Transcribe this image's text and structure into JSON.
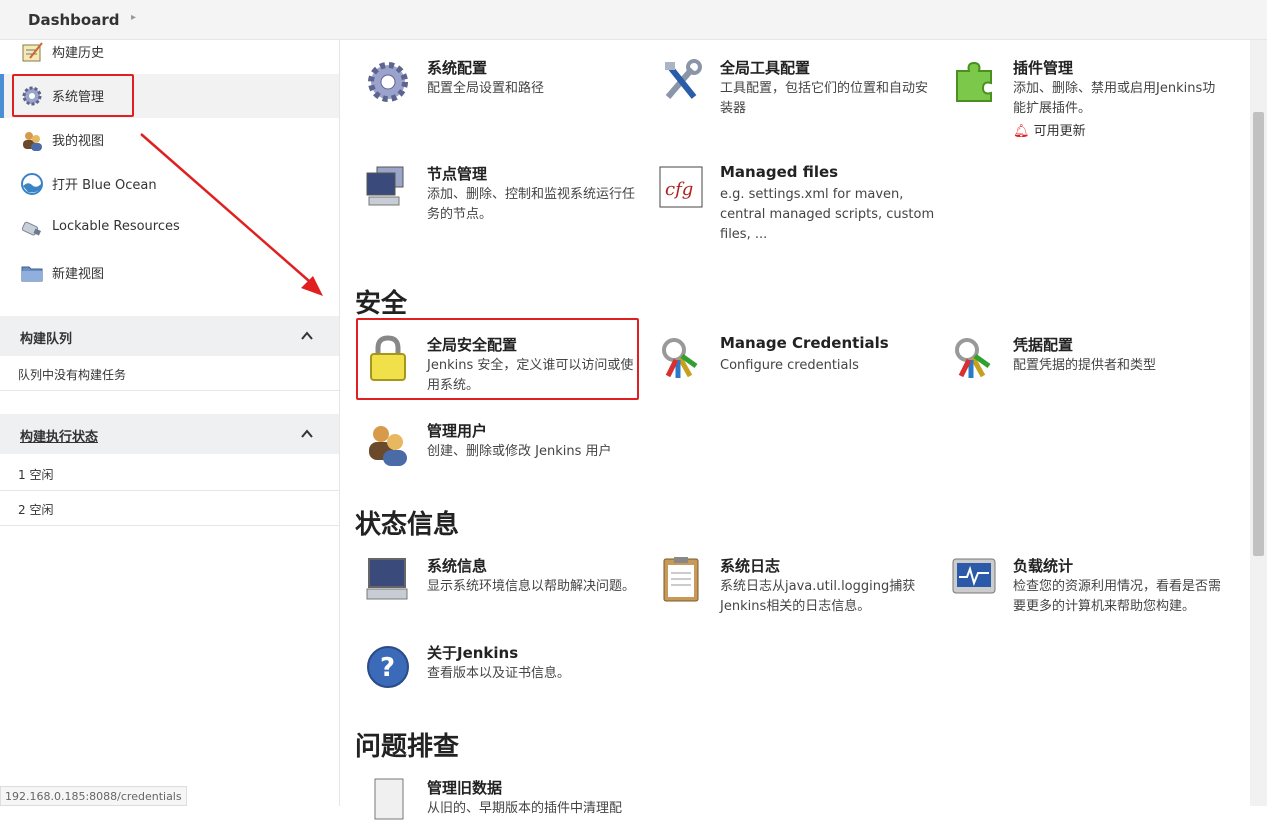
{
  "header": {
    "breadcrumb": "Dashboard"
  },
  "sidebar": {
    "items": [
      {
        "label": "构建历史",
        "icon": "notepad-icon"
      },
      {
        "label": "系统管理",
        "icon": "gear-icon"
      },
      {
        "label": "我的视图",
        "icon": "users-icon"
      },
      {
        "label": "打开 Blue Ocean",
        "icon": "blue-ocean-icon"
      },
      {
        "label": "Lockable Resources",
        "icon": "usb-icon"
      },
      {
        "label": "新建视图",
        "icon": "folder-icon"
      }
    ],
    "queue": {
      "title": "构建队列",
      "empty_text": "队列中没有构建任务"
    },
    "executors": {
      "title": "构建执行状态",
      "rows": [
        "1  空闲",
        "2  空闲"
      ]
    }
  },
  "status_url": "192.168.0.185:8088/credentials",
  "main": {
    "tiles_top": [
      {
        "title": "系统配置",
        "desc": "配置全局设置和路径"
      },
      {
        "title": "全局工具配置",
        "desc": "工具配置，包括它们的位置和自动安装器"
      },
      {
        "title": "插件管理",
        "desc": "添加、删除、禁用或启用Jenkins功能扩展插件。",
        "update": "可用更新"
      },
      {
        "title": "节点管理",
        "desc": "添加、删除、控制和监视系统运行任务的节点。"
      },
      {
        "title": "Managed files",
        "desc": "e.g. settings.xml for maven, central managed scripts, custom files, ..."
      }
    ],
    "security": {
      "heading": "安全",
      "tiles": [
        {
          "title": "全局安全配置",
          "desc": "Jenkins 安全，定义谁可以访问或使用系统。"
        },
        {
          "title": "Manage Credentials",
          "desc": "Configure credentials"
        },
        {
          "title": "凭据配置",
          "desc": "配置凭据的提供者和类型"
        },
        {
          "title": "管理用户",
          "desc": "创建、删除或修改 Jenkins 用户"
        }
      ]
    },
    "status": {
      "heading": "状态信息",
      "tiles": [
        {
          "title": "系统信息",
          "desc": "显示系统环境信息以帮助解决问题。"
        },
        {
          "title": "系统日志",
          "desc": "系统日志从java.util.logging捕获Jenkins相关的日志信息。"
        },
        {
          "title": "负载统计",
          "desc": "检查您的资源利用情况，看看是否需要更多的计算机来帮助您构建。"
        },
        {
          "title": "关于Jenkins",
          "desc": "查看版本以及证书信息。"
        }
      ]
    },
    "troubleshoot": {
      "heading": "问题排查",
      "tiles": [
        {
          "title": "管理旧数据",
          "desc": "从旧的、早期版本的插件中清理配"
        }
      ]
    }
  },
  "colors": {
    "highlight": "#e02020",
    "active_bar": "#4b8ed4"
  }
}
